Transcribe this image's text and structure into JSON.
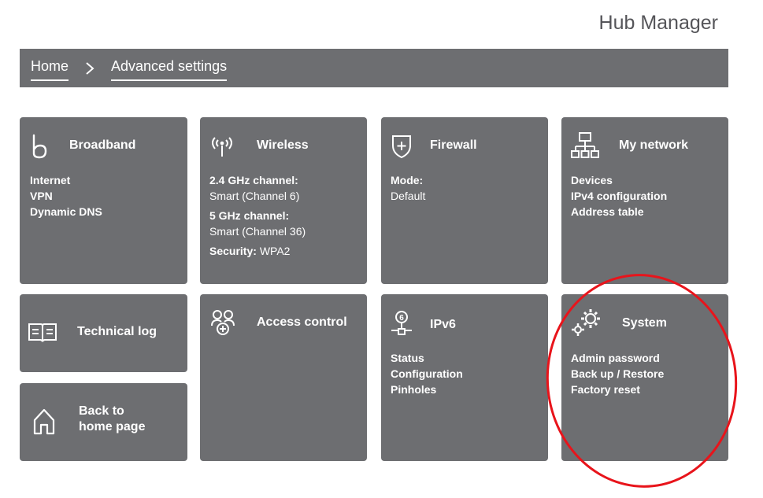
{
  "header": {
    "title": "Hub Manager"
  },
  "breadcrumb": {
    "home": "Home",
    "current": "Advanced settings"
  },
  "tiles": {
    "broadband": {
      "title": "Broadband",
      "links": [
        "Internet",
        "VPN",
        "Dynamic DNS"
      ]
    },
    "wireless": {
      "title": "Wireless",
      "ch24_label": "2.4 GHz channel:",
      "ch24_value": "Smart (Channel 6)",
      "ch5_label": "5 GHz channel:",
      "ch5_value": "Smart (Channel 36)",
      "security_label": "Security:",
      "security_value": "WPA2"
    },
    "firewall": {
      "title": "Firewall",
      "mode_label": "Mode:",
      "mode_value": "Default"
    },
    "my_network": {
      "title": "My network",
      "links": [
        "Devices",
        "IPv4 configuration",
        "Address table"
      ]
    },
    "technical_log": {
      "title": "Technical log"
    },
    "access_control": {
      "title": "Access control"
    },
    "ipv6": {
      "title": "IPv6",
      "icon_digit": "6",
      "links": [
        "Status",
        "Configuration",
        "Pinholes"
      ]
    },
    "system": {
      "title": "System",
      "links": [
        "Admin password",
        "Back up / Restore",
        "Factory reset"
      ]
    },
    "back_home": {
      "title_line1": "Back to",
      "title_line2": "home page"
    }
  },
  "colors": {
    "tile_bg": "#6d6e71",
    "highlight_ring": "#e8141b",
    "header_text": "#555559"
  },
  "icons": {
    "broadband": "broadband-b-icon",
    "wireless": "antenna-icon",
    "firewall": "shield-plus-icon",
    "my_network": "network-tree-icon",
    "technical_log": "book-icon",
    "access_control": "people-plus-icon",
    "ipv6": "ipv6-node-icon",
    "system": "gears-icon",
    "back_home": "house-icon"
  }
}
